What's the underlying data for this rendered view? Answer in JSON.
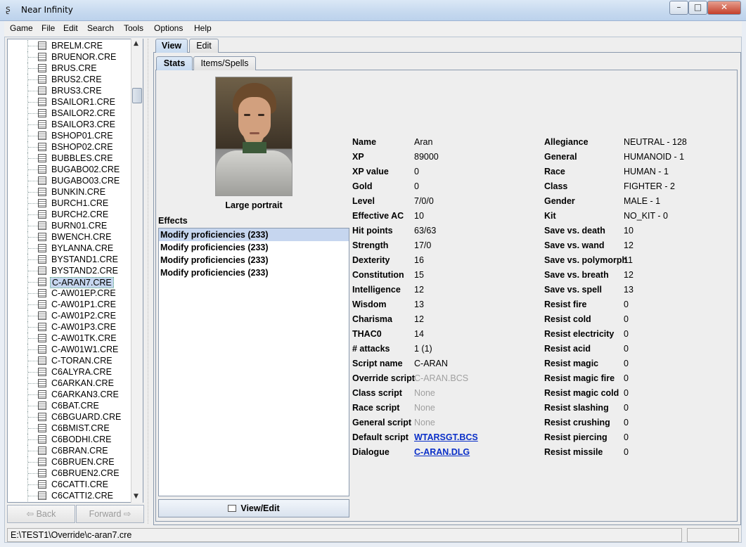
{
  "window": {
    "title": "Near Infinity"
  },
  "menu": [
    {
      "label": "Game"
    },
    {
      "label": "File"
    },
    {
      "label": "Edit"
    },
    {
      "label": "Search"
    },
    {
      "label": "Tools"
    },
    {
      "label": "Options"
    },
    {
      "label": "Help"
    }
  ],
  "tree": {
    "items": [
      "BRELM.CRE",
      "BRUENOR.CRE",
      "BRUS.CRE",
      "BRUS2.CRE",
      "BRUS3.CRE",
      "BSAILOR1.CRE",
      "BSAILOR2.CRE",
      "BSAILOR3.CRE",
      "BSHOP01.CRE",
      "BSHOP02.CRE",
      "BUBBLES.CRE",
      "BUGABO02.CRE",
      "BUGABO03.CRE",
      "BUNKIN.CRE",
      "BURCH1.CRE",
      "BURCH2.CRE",
      "BURN01.CRE",
      "BWENCH.CRE",
      "BYLANNA.CRE",
      "BYSTAND1.CRE",
      "BYSTAND2.CRE",
      "C-ARAN7.CRE",
      "C-AW01EP.CRE",
      "C-AW01P1.CRE",
      "C-AW01P2.CRE",
      "C-AW01P3.CRE",
      "C-AW01TK.CRE",
      "C-AW01W1.CRE",
      "C-TORAN.CRE",
      "C6ALYRA.CRE",
      "C6ARKAN.CRE",
      "C6ARKAN3.CRE",
      "C6BAT.CRE",
      "C6BGUARD.CRE",
      "C6BMIST.CRE",
      "C6BODHI.CRE",
      "C6BRAN.CRE",
      "C6BRUEN.CRE",
      "C6BRUEN2.CRE",
      "C6CATTI.CRE",
      "C6CATTI2.CRE"
    ],
    "selected": "C-ARAN7.CRE"
  },
  "nav": {
    "back": "Back",
    "forward": "Forward"
  },
  "tabs": {
    "outer": [
      "View",
      "Edit"
    ],
    "inner": [
      "Stats",
      "Items/Spells"
    ]
  },
  "portrait": {
    "caption": "Large portrait"
  },
  "effects": {
    "title": "Effects",
    "items": [
      "Modify proficiencies (233)",
      "Modify proficiencies (233)",
      "Modify proficiencies (233)",
      "Modify proficiencies (233)"
    ]
  },
  "view_edit_label": "View/Edit",
  "stats_left": [
    {
      "label": "Name",
      "value": "Aran"
    },
    {
      "label": "XP",
      "value": "89000"
    },
    {
      "label": "XP value",
      "value": "0"
    },
    {
      "label": "Gold",
      "value": "0"
    },
    {
      "label": "Level",
      "value": "7/0/0"
    },
    {
      "label": "Effective AC",
      "value": "10"
    },
    {
      "label": "Hit points",
      "value": "63/63"
    },
    {
      "label": "Strength",
      "value": "17/0"
    },
    {
      "label": "Dexterity",
      "value": "16"
    },
    {
      "label": "Constitution",
      "value": "15"
    },
    {
      "label": "Intelligence",
      "value": "12"
    },
    {
      "label": "Wisdom",
      "value": "13"
    },
    {
      "label": "Charisma",
      "value": "12"
    },
    {
      "label": "THAC0",
      "value": "14"
    },
    {
      "label": "# attacks",
      "value": "1 (1)"
    },
    {
      "label": "Script name",
      "value": "C-ARAN"
    },
    {
      "label": "Override script",
      "value": "C-ARAN.BCS",
      "style": "dim"
    },
    {
      "label": "Class script",
      "value": "None",
      "style": "dim"
    },
    {
      "label": "Race script",
      "value": "None",
      "style": "dim"
    },
    {
      "label": "General script",
      "value": "None",
      "style": "dim"
    },
    {
      "label": "Default script",
      "value": "WTARSGT.BCS",
      "style": "link"
    },
    {
      "label": "Dialogue",
      "value": "C-ARAN.DLG",
      "style": "link"
    }
  ],
  "stats_right": [
    {
      "label": "Allegiance",
      "value": "NEUTRAL - 128"
    },
    {
      "label": "General",
      "value": "HUMANOID - 1"
    },
    {
      "label": "Race",
      "value": "HUMAN - 1"
    },
    {
      "label": "Class",
      "value": "FIGHTER - 2"
    },
    {
      "label": "Gender",
      "value": "MALE - 1"
    },
    {
      "label": "Kit",
      "value": "NO_KIT - 0"
    },
    {
      "label": "Save vs. death",
      "value": "10"
    },
    {
      "label": "Save vs. wand",
      "value": "12"
    },
    {
      "label": "Save vs. polymorph",
      "value": "11"
    },
    {
      "label": "Save vs. breath",
      "value": "12"
    },
    {
      "label": "Save vs. spell",
      "value": "13"
    },
    {
      "label": "Resist fire",
      "value": "0"
    },
    {
      "label": "Resist cold",
      "value": "0"
    },
    {
      "label": "Resist electricity",
      "value": "0"
    },
    {
      "label": "Resist acid",
      "value": "0"
    },
    {
      "label": "Resist magic",
      "value": "0"
    },
    {
      "label": "Resist magic fire",
      "value": "0"
    },
    {
      "label": "Resist magic cold",
      "value": "0"
    },
    {
      "label": "Resist slashing",
      "value": "0"
    },
    {
      "label": "Resist crushing",
      "value": "0"
    },
    {
      "label": "Resist piercing",
      "value": "0"
    },
    {
      "label": "Resist missile",
      "value": "0"
    }
  ],
  "status": {
    "path": "E:\\TEST1\\Override\\c-aran7.cre"
  }
}
